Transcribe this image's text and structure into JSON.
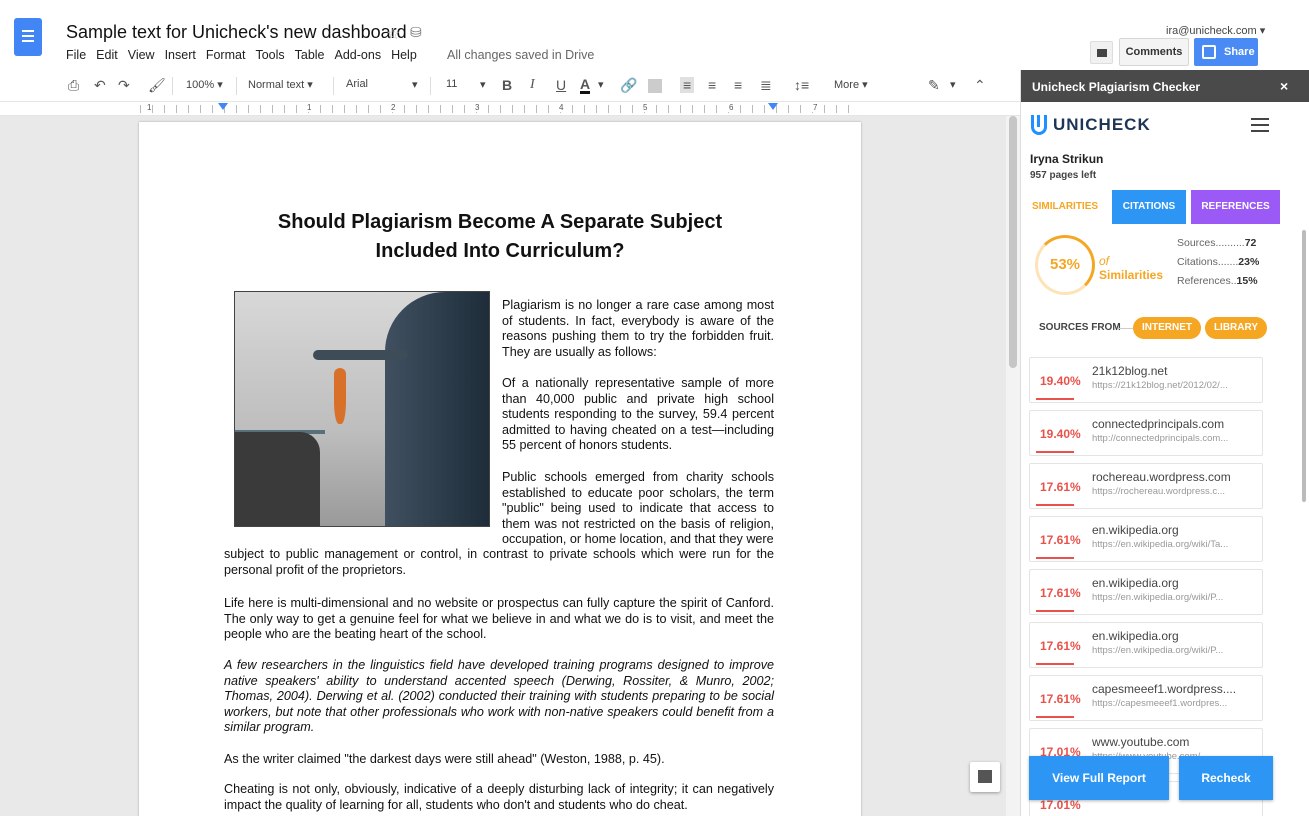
{
  "doc": {
    "title": "Sample text for Unicheck's new dashboard",
    "menu": [
      "File",
      "Edit",
      "View",
      "Insert",
      "Format",
      "Tools",
      "Table",
      "Add-ons",
      "Help"
    ],
    "save_status": "All changes saved in Drive",
    "account": "ira@unicheck.com",
    "comments_label": "Comments",
    "share_label": "Share"
  },
  "toolbar": {
    "zoom": "100%",
    "style": "Normal text",
    "font": "Arial",
    "size": "11",
    "more": "More",
    "bold": "B",
    "italic": "I",
    "underline": "U",
    "color": "A",
    "ruler_nums": [
      "1",
      "1",
      "2",
      "3",
      "4",
      "5",
      "6",
      "7"
    ]
  },
  "body": {
    "heading": "Should Plagiarism Become A Separate Subject Included Into Curriculum?",
    "p1": "Plagiarism is no longer a rare case among most of students. In fact, everybody is aware of the reasons pushing them to try the forbidden fruit. They are usually as follows:",
    "p2": "Of a nationally representative sample of more than 40,000 public and private high school students responding to the survey, 59.4 percent admitted to having cheated on a test—including 55 percent of honors students.",
    "p3a": "Public schools emerged from charity schools established to educate poor scholars, the term \"public\" being used to indicate that access to them was not restricted on the basis of religion, occupation, or home location, and that they were",
    "p3b": "subject to public management or control, in contrast to private schools which were run for the personal profit of the proprietors.",
    "p4": "Life here is multi-dimensional and no website or prospectus can fully capture the spirit of Canford. The only way to get a genuine feel for what we believe in and what we do is to visit, and meet the people who are the beating heart of the school.",
    "p5": "A few researchers in the linguistics field have developed training programs designed to improve native speakers' ability to understand accented speech (Derwing, Rossiter, & Munro, 2002; Thomas, 2004). Derwing et al. (2002) conducted their training with students preparing to be social workers, but note that other professionals who work with non-native speakers could benefit from a similar program.",
    "p6": "As the writer claimed \"the darkest days were still ahead\" (Weston, 1988, p. 45).",
    "p7": "Cheating is not only, obviously, indicative of a deeply disturbing lack of integrity; it can negatively impact the quality of learning for all, students who don't and students who do cheat."
  },
  "panel": {
    "title": "Unicheck Plagiarism Checker",
    "close": "×",
    "brand": "UNICHECK",
    "user": "Iryna Strikun",
    "pages_left": "957 pages left",
    "tabs": [
      "SIMILARITIES",
      "CITATIONS",
      "REFERENCES"
    ],
    "similarity_pct": "53%",
    "similarity_of": "of",
    "similarity_label": "Similarities",
    "stats": {
      "sources": "Sources..........",
      "sources_val": "72",
      "citations": "Citations.......",
      "citations_val": "23%",
      "references": "References..",
      "references_val": "15%"
    },
    "sources_from": "SOURCES FROM",
    "chips": [
      "INTERNET",
      "LIBRARY"
    ],
    "results": [
      {
        "pct": "19.40%",
        "domain": "21k12blog.net",
        "url": "https://21k12blog.net/2012/02/..."
      },
      {
        "pct": "19.40%",
        "domain": "connectedprincipals.com",
        "url": "http://connectedprincipals.com..."
      },
      {
        "pct": "17.61%",
        "domain": "rochereau.wordpress.com",
        "url": "https://rochereau.wordpress.c..."
      },
      {
        "pct": "17.61%",
        "domain": "en.wikipedia.org",
        "url": "https://en.wikipedia.org/wiki/Ta..."
      },
      {
        "pct": "17.61%",
        "domain": "en.wikipedia.org",
        "url": "https://en.wikipedia.org/wiki/P..."
      },
      {
        "pct": "17.61%",
        "domain": "en.wikipedia.org",
        "url": "https://en.wikipedia.org/wiki/P..."
      },
      {
        "pct": "17.61%",
        "domain": "capesmeeef1.wordpress....",
        "url": "https://capesmeeef1.wordpres..."
      },
      {
        "pct": "17.01%",
        "domain": "www.youtube.com",
        "url": "https://www.youtube.com/..."
      },
      {
        "pct": "17.01%",
        "domain": "",
        "url": ""
      }
    ],
    "view_report": "View Full Report",
    "recheck": "Recheck"
  },
  "colors": {
    "accent": "#2d96f5",
    "similarity": "#f5a623",
    "match": "#e8524a",
    "references": "#9b59f5"
  }
}
